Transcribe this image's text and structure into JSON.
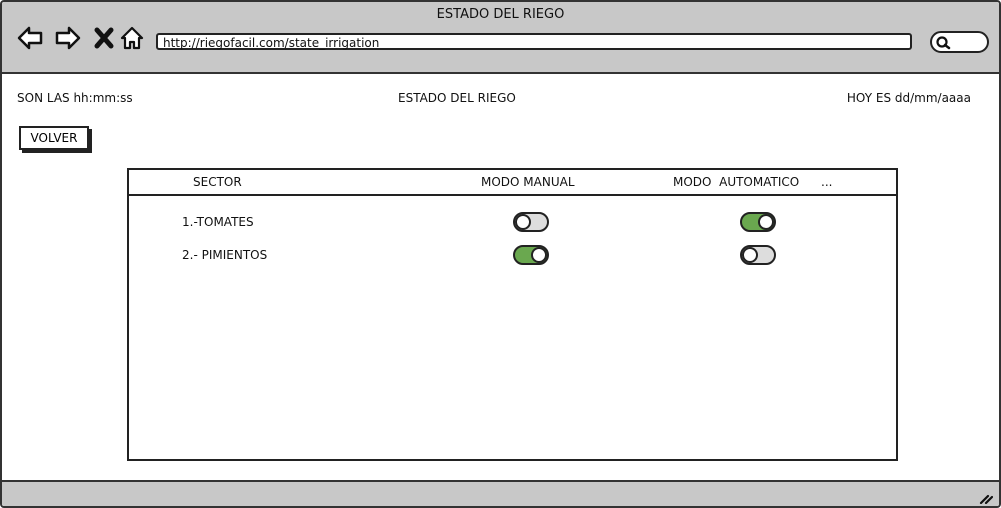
{
  "window": {
    "title": "ESTADO DEL RIEGO"
  },
  "browser": {
    "url": "http://riegofacil.com/state_irrigation",
    "nav_icons": [
      "back-icon",
      "forward-icon",
      "close-icon",
      "home-icon"
    ],
    "search_icon": "search-icon"
  },
  "header": {
    "time_label": "SON LAS hh:mm:ss",
    "page_title": "ESTADO DEL RIEGO",
    "date_label": "HOY ES dd/mm/aaaa"
  },
  "actions": {
    "back_label": "VOLVER"
  },
  "table": {
    "columns": [
      "SECTOR",
      "MODO MANUAL",
      "MODO  AUTOMATICO",
      "..."
    ],
    "rows": [
      {
        "sector": "1.-TOMATES",
        "manual": false,
        "automatico": true
      },
      {
        "sector": "2.- PIMIENTOS",
        "manual": true,
        "automatico": false
      }
    ]
  },
  "colors": {
    "toggle_on": "#6aa84f",
    "toggle_off": "#dddddd",
    "chrome": "#c8c8c8"
  }
}
